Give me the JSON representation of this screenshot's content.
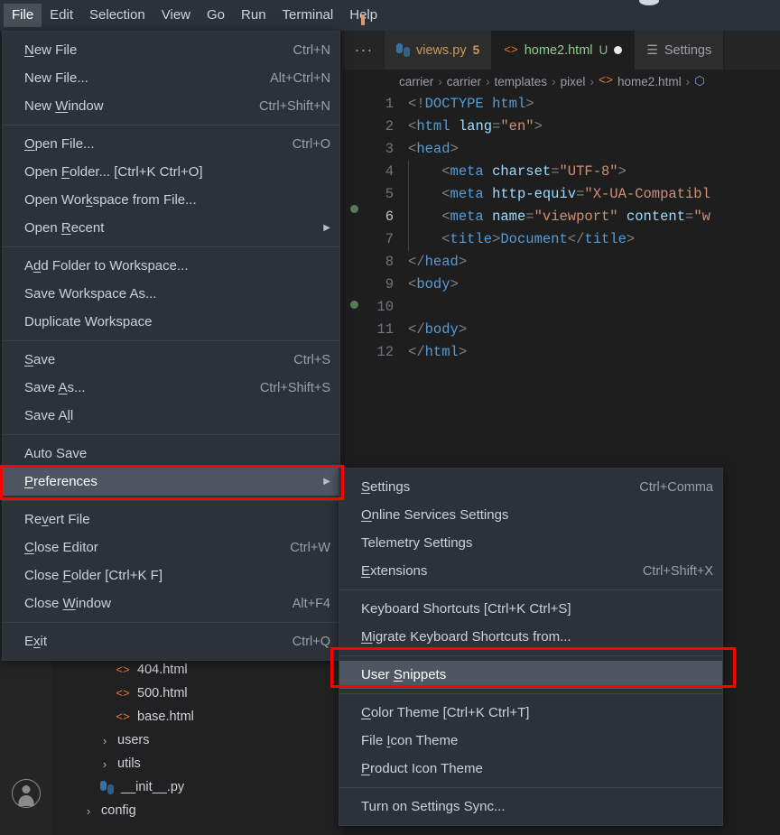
{
  "menubar": {
    "items": [
      {
        "label": "File",
        "active": true
      },
      {
        "label": "Edit",
        "active": false
      },
      {
        "label": "Selection",
        "active": false
      },
      {
        "label": "View",
        "active": false
      },
      {
        "label": "Go",
        "active": false
      },
      {
        "label": "Run",
        "active": false
      },
      {
        "label": "Terminal",
        "active": false
      },
      {
        "label": "Help",
        "active": false
      }
    ]
  },
  "file_menu": {
    "groups": [
      [
        {
          "label": "New File",
          "accel": "N",
          "keys": "Ctrl+N"
        },
        {
          "label": "New File...",
          "accel": "",
          "keys": "Alt+Ctrl+N"
        },
        {
          "label": "New Window",
          "accel": "W",
          "keys": "Ctrl+Shift+N"
        }
      ],
      [
        {
          "label": "Open File...",
          "accel": "O",
          "keys": "Ctrl+O"
        },
        {
          "label": "Open Folder... [Ctrl+K Ctrl+O]",
          "accel": "F",
          "keys": ""
        },
        {
          "label": "Open Workspace from File...",
          "accel": "k",
          "keys": ""
        },
        {
          "label": "Open Recent",
          "accel": "R",
          "keys": "",
          "submenu": true
        }
      ],
      [
        {
          "label": "Add Folder to Workspace...",
          "accel": "d",
          "keys": ""
        },
        {
          "label": "Save Workspace As...",
          "accel": "",
          "keys": ""
        },
        {
          "label": "Duplicate Workspace",
          "accel": "",
          "keys": ""
        }
      ],
      [
        {
          "label": "Save",
          "accel": "S",
          "keys": "Ctrl+S"
        },
        {
          "label": "Save As...",
          "accel": "A",
          "keys": "Ctrl+Shift+S"
        },
        {
          "label": "Save All",
          "accel": "l",
          "keys": ""
        }
      ],
      [
        {
          "label": "Auto Save",
          "accel": "",
          "keys": ""
        },
        {
          "label": "Preferences",
          "accel": "P",
          "keys": "",
          "submenu": true,
          "selected": true
        }
      ],
      [
        {
          "label": "Revert File",
          "accel": "v",
          "keys": ""
        },
        {
          "label": "Close Editor",
          "accel": "C",
          "keys": "Ctrl+W"
        },
        {
          "label": "Close Folder [Ctrl+K F]",
          "accel": "F",
          "keys": ""
        },
        {
          "label": "Close Window",
          "accel": "W",
          "keys": "Alt+F4"
        }
      ],
      [
        {
          "label": "Exit",
          "accel": "x",
          "keys": "Ctrl+Q"
        }
      ]
    ]
  },
  "preferences_menu": {
    "groups": [
      [
        {
          "label": "Settings",
          "accel": "S",
          "keys": "Ctrl+Comma"
        },
        {
          "label": "Online Services Settings",
          "accel": "O",
          "keys": ""
        },
        {
          "label": "Telemetry Settings",
          "accel": "",
          "keys": ""
        },
        {
          "label": "Extensions",
          "accel": "E",
          "keys": "Ctrl+Shift+X"
        }
      ],
      [
        {
          "label": "Keyboard Shortcuts [Ctrl+K Ctrl+S]",
          "accel": "",
          "keys": ""
        },
        {
          "label": "Migrate Keyboard Shortcuts from...",
          "accel": "M",
          "keys": ""
        }
      ],
      [
        {
          "label": "User Snippets",
          "accel": "S",
          "keys": "",
          "selected": true
        }
      ],
      [
        {
          "label": "Color Theme [Ctrl+K Ctrl+T]",
          "accel": "C",
          "keys": ""
        },
        {
          "label": "File Icon Theme",
          "accel": "I",
          "keys": ""
        },
        {
          "label": "Product Icon Theme",
          "accel": "P",
          "keys": ""
        }
      ],
      [
        {
          "label": "Turn on Settings Sync...",
          "accel": "",
          "keys": ""
        }
      ]
    ]
  },
  "tabs": {
    "overflow_label": "···",
    "items": [
      {
        "icon": "python-icon",
        "name": "views.py",
        "badge": "5",
        "modified": false,
        "active": false
      },
      {
        "icon": "html-icon",
        "name": "home2.html",
        "badge": "U",
        "modified": true,
        "active": true
      },
      {
        "icon": "settings-icon",
        "name": "Settings",
        "badge": "",
        "modified": false,
        "active": false
      }
    ]
  },
  "breadcrumb": {
    "parts": [
      "carrier",
      "carrier",
      "templates",
      "pixel",
      "home2.html"
    ],
    "trailing_icon": "cube-icon"
  },
  "editor": {
    "lines": [
      {
        "num": "1",
        "text": "<!DOCTYPE html>"
      },
      {
        "num": "2",
        "text": "<html lang=\"en\">"
      },
      {
        "num": "3",
        "text": "<head>"
      },
      {
        "num": "4",
        "text": "    <meta charset=\"UTF-8\">"
      },
      {
        "num": "5",
        "text": "    <meta http-equiv=\"X-UA-Compatibl"
      },
      {
        "num": "6",
        "text": "    <meta name=\"viewport\" content=\"w"
      },
      {
        "num": "7",
        "text": "    <title>Document</title>"
      },
      {
        "num": "8",
        "text": "</head>"
      },
      {
        "num": "9",
        "text": "<body>"
      },
      {
        "num": "10",
        "text": ""
      },
      {
        "num": "11",
        "text": "</body>"
      },
      {
        "num": "12",
        "text": "</html>"
      }
    ]
  },
  "explorer": {
    "items": [
      {
        "label": "404.html",
        "icon": "html-icon",
        "depth": 3,
        "kind": "file"
      },
      {
        "label": "500.html",
        "icon": "html-icon",
        "depth": 3,
        "kind": "file"
      },
      {
        "label": "base.html",
        "icon": "html-icon",
        "depth": 3,
        "kind": "file"
      },
      {
        "label": "users",
        "icon": "chevron-right-icon",
        "depth": 2,
        "kind": "folder"
      },
      {
        "label": "utils",
        "icon": "chevron-right-icon",
        "depth": 2,
        "kind": "folder"
      },
      {
        "label": "__init__.py",
        "icon": "python-icon",
        "depth": 2,
        "kind": "file"
      },
      {
        "label": "config",
        "icon": "chevron-right-icon",
        "depth": 1,
        "kind": "folder"
      }
    ]
  },
  "activitybar": {
    "account_label": "account-icon"
  },
  "colors": {
    "menu_bg": "#2c313a",
    "menu_selected": "#4f5662",
    "annotation_red": "#ff0000",
    "editor_bg": "#1e1e1e",
    "sidebar_bg": "#212121",
    "tabbar_bg": "#252526",
    "html_icon": "#e37933",
    "dirty_dot": "#e8e8e8",
    "breakpoint_dot": "#587c59"
  }
}
